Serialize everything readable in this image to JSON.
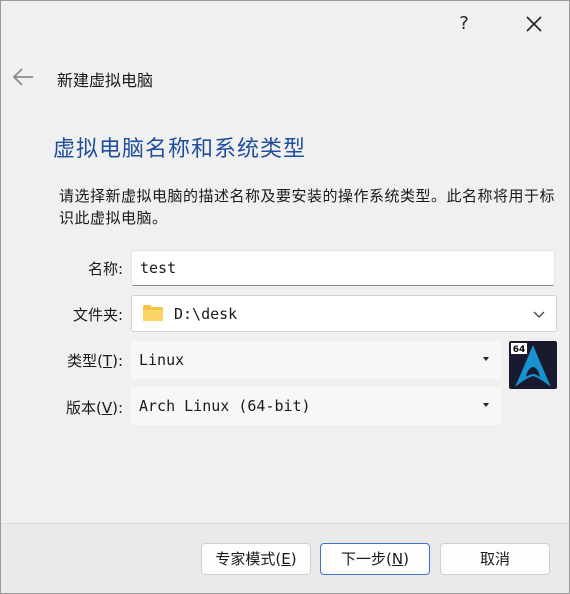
{
  "dialog": {
    "help_glyph": "?",
    "wizard_title": "新建虚拟电脑",
    "heading": "虚拟电脑名称和系统类型",
    "description": "请选择新虚拟电脑的描述名称及要安装的操作系统类型。此名称将用于标识此虚拟电脑。"
  },
  "form": {
    "name_label": "名称:",
    "name_value": "test",
    "folder_label": "文件夹:",
    "folder_value": "D:\\desk",
    "type_label_text": "类型(",
    "type_label_key": "T",
    "type_label_end": "):",
    "type_value": "Linux",
    "version_label_text": "版本(",
    "version_label_key": "V",
    "version_label_end": "):",
    "version_value": "Arch Linux (64-bit)",
    "os_badge": "64"
  },
  "buttons": {
    "expert_text": "专家模式(",
    "expert_key": "E",
    "expert_end": ")",
    "next_text": "下一步(",
    "next_key": "N",
    "next_end": ")",
    "cancel": "取消"
  },
  "icons": {
    "help": "help-icon",
    "close": "close-icon",
    "back": "back-arrow-icon",
    "folder": "folder-icon",
    "chevron": "chevron-down-icon",
    "os": "arch-linux-icon"
  },
  "colors": {
    "heading": "#1f4e9c",
    "accent": "#3b73c9",
    "folder": "#f5c242",
    "arch_blue": "#1793d1"
  }
}
